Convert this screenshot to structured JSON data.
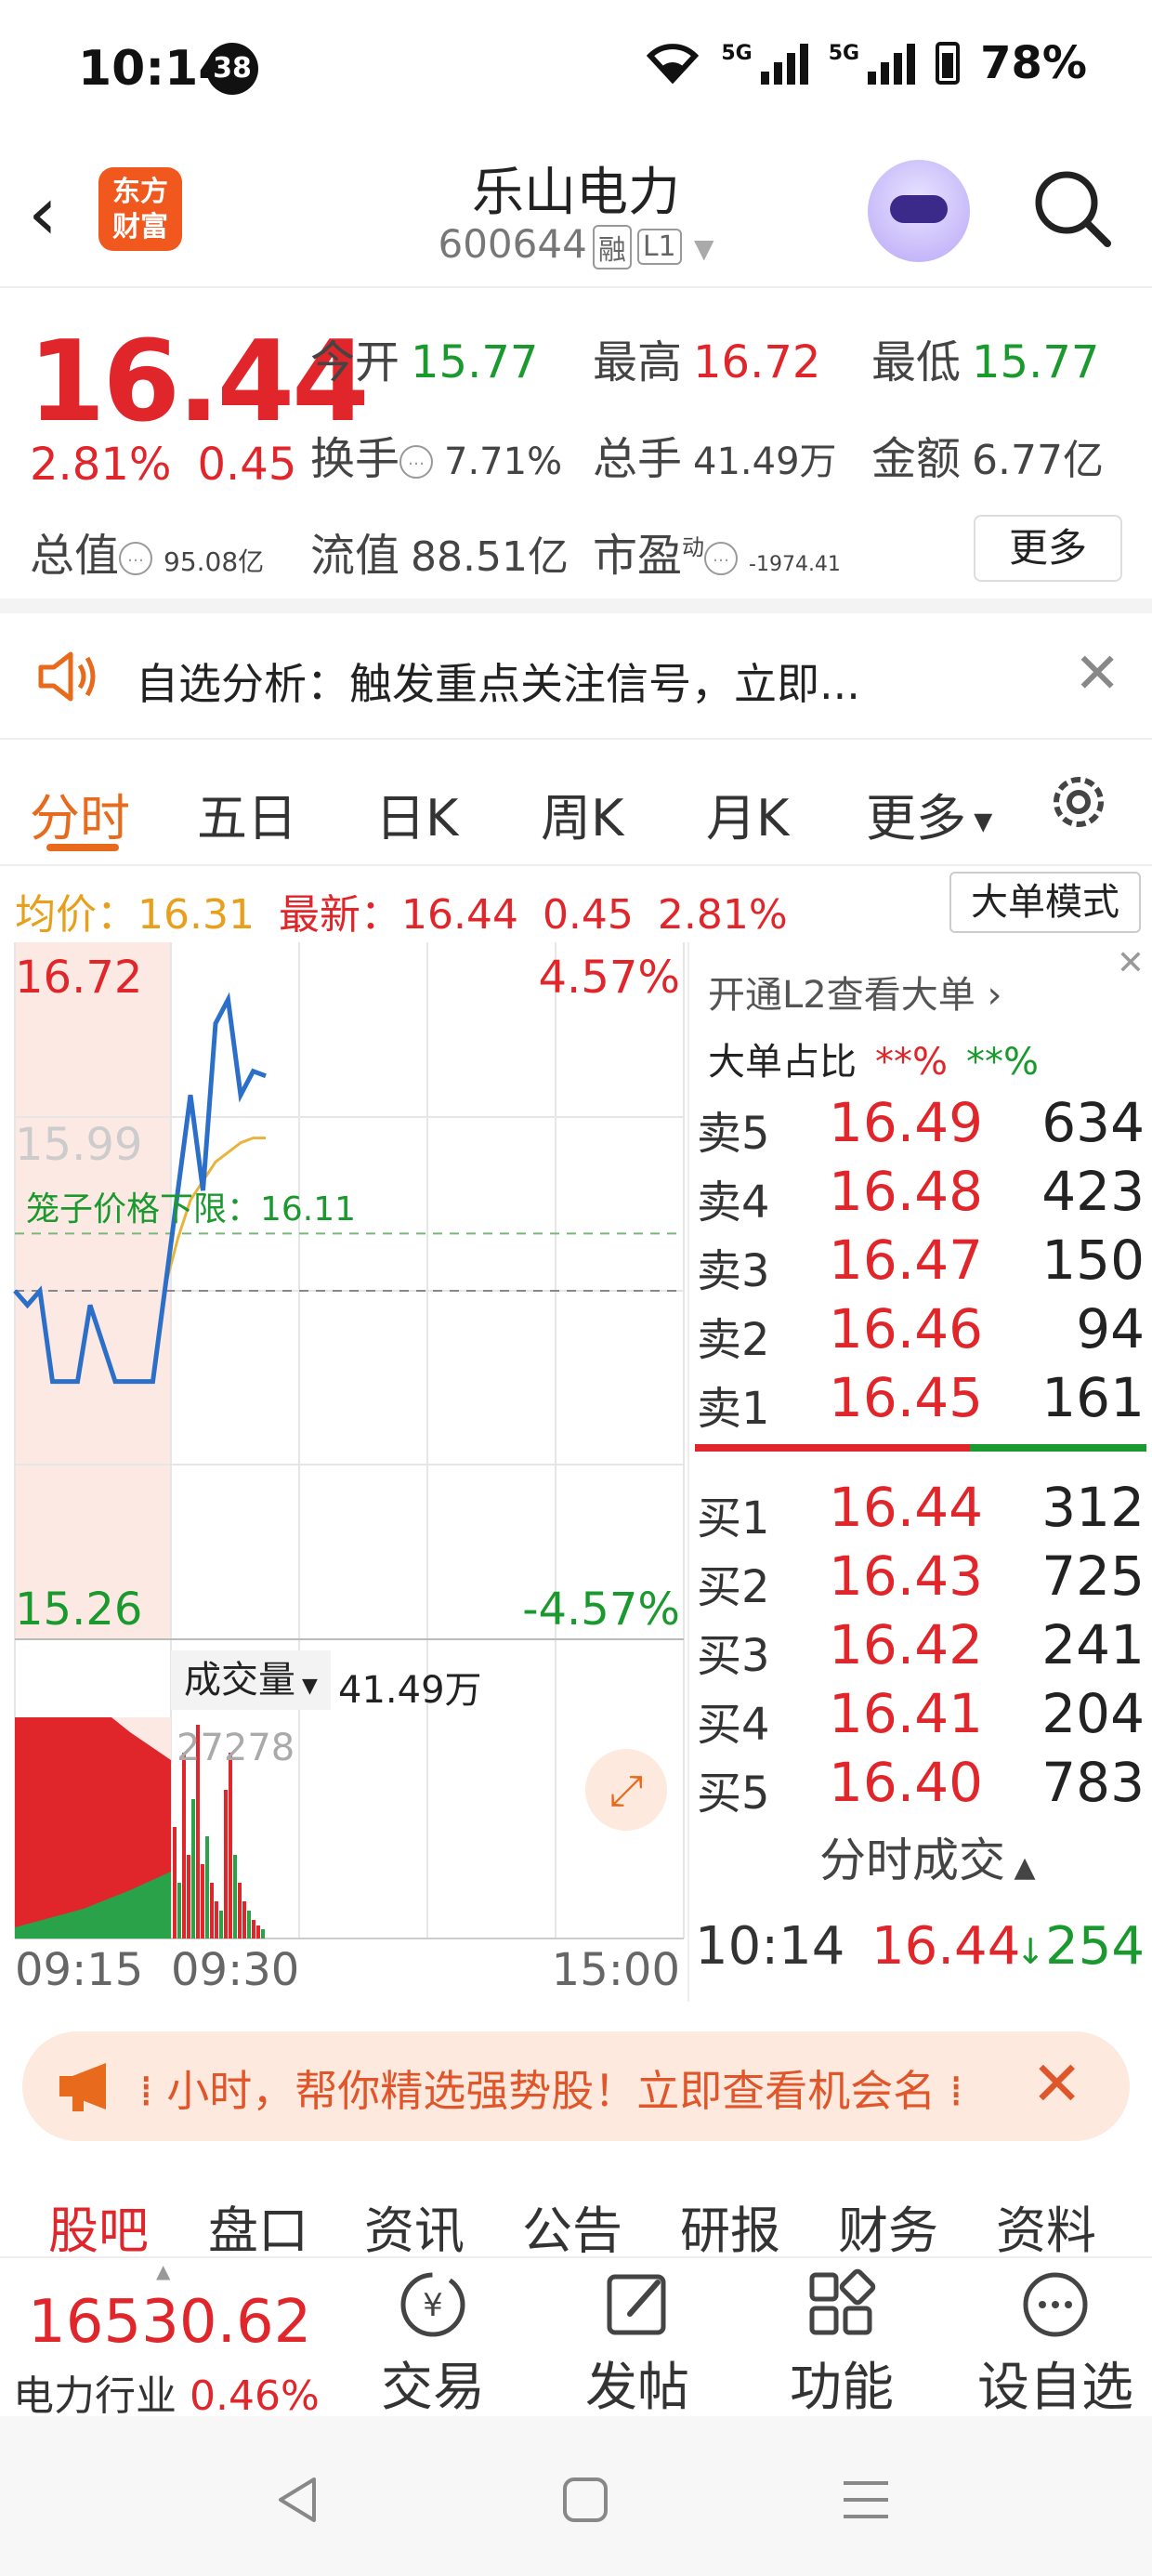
{
  "status": {
    "time": "10:14",
    "badge": "38",
    "net1": "5G",
    "net2": "5G",
    "battery": "78%"
  },
  "header": {
    "title": "乐山电力",
    "code": "600644",
    "tag1": "融",
    "tag2": "L1",
    "logo_line1": "东方",
    "logo_line2": "财富"
  },
  "quote": {
    "price": "16.44",
    "pct": "2.81%",
    "chg": "0.45",
    "open_label": "今开",
    "open": "15.77",
    "high_label": "最高",
    "high": "16.72",
    "low_label": "最低",
    "low": "15.77",
    "turnover_label": "换手",
    "turnover": "7.71%",
    "volume_label": "总手",
    "volume": "41.49万",
    "amount_label": "金额",
    "amount": "6.77亿",
    "mcap_label": "总值",
    "mcap": "95.08亿",
    "float_label": "流值",
    "float": "88.51亿",
    "pe_label": "市盈",
    "pe_sup": "动",
    "pe": "-1974.41",
    "more": "更多"
  },
  "notice": {
    "text": "自选分析：触发重点关注信号，立即..."
  },
  "tabs": [
    "分时",
    "五日",
    "日K",
    "周K",
    "月K",
    "更多"
  ],
  "info": {
    "avg_label": "均价：",
    "avg": "16.31",
    "last_label": "最新：",
    "last": "16.44",
    "chg": "0.45",
    "pct": "2.81%",
    "mode_btn": "大单模式"
  },
  "chart": {
    "top_price": "16.72",
    "top_pct": "4.57%",
    "mid_price": "15.99",
    "bottom_price": "15.26",
    "bottom_pct": "-4.57%",
    "cage_label": "笼子价格下限：16.11",
    "vol_selector": "成交量",
    "vol_total": "41.49万",
    "vol_peak": "27278",
    "t_start": "09:15",
    "t_mid": "09:30",
    "t_end": "15:00"
  },
  "chart_data": {
    "type": "line",
    "title": "",
    "ylim": [
      15.26,
      16.72
    ],
    "series": [
      {
        "values": [
          15.99,
          15.96,
          15.99,
          15.8,
          15.8,
          15.8,
          15.96,
          15.88,
          15.8,
          15.8,
          15.8,
          15.8,
          16.0,
          16.2,
          16.4,
          16.2,
          16.55,
          16.6,
          16.4,
          16.45,
          16.44
        ]
      },
      {
        "values": [
          15.99,
          15.99,
          15.99,
          15.99,
          15.99,
          15.99,
          15.99,
          15.99,
          15.99,
          15.99,
          15.99,
          15.99,
          16.0,
          16.1,
          16.18,
          16.22,
          16.26,
          16.28,
          16.3,
          16.31,
          16.31
        ]
      }
    ]
  },
  "book": {
    "promo": "开通L2查看大单",
    "ratio_label": "大单占比",
    "ratio_a": "**%",
    "ratio_b": "**%",
    "asks": [
      {
        "label": "卖5",
        "price": "16.49",
        "qty": "634"
      },
      {
        "label": "卖4",
        "price": "16.48",
        "qty": "423"
      },
      {
        "label": "卖3",
        "price": "16.47",
        "qty": "150"
      },
      {
        "label": "卖2",
        "price": "16.46",
        "qty": "94"
      },
      {
        "label": "卖1",
        "price": "16.45",
        "qty": "161"
      }
    ],
    "bids": [
      {
        "label": "买1",
        "price": "16.44",
        "qty": "312"
      },
      {
        "label": "买2",
        "price": "16.43",
        "qty": "725"
      },
      {
        "label": "买3",
        "price": "16.42",
        "qty": "241"
      },
      {
        "label": "买4",
        "price": "16.41",
        "qty": "204"
      },
      {
        "label": "买5",
        "price": "16.40",
        "qty": "783"
      }
    ],
    "ticks_label": "分时成交",
    "tick_time": "10:14",
    "tick_price": "16.44",
    "tick_qty": "254"
  },
  "banner": {
    "text": "⁞ 小时，帮你精选强势股！立即查看机会名 ⁞"
  },
  "subtabs": [
    "股吧",
    "盘口",
    "资讯",
    "公告",
    "研报",
    "财务",
    "资料"
  ],
  "bottom": {
    "index_value": "16530.62",
    "index_name": "电力行业",
    "index_pct": "0.46%",
    "b1": "交易",
    "b2": "发帖",
    "b3": "功能",
    "b4": "设自选"
  }
}
